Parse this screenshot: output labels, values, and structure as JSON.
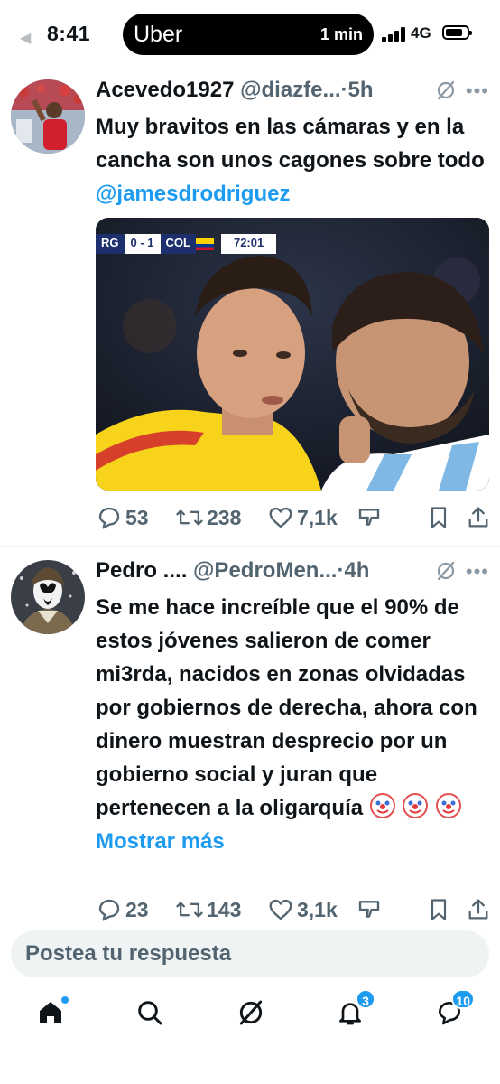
{
  "status_bar": {
    "time": "8:41",
    "app_pill": {
      "brand": "Uber",
      "eta": "1 min"
    },
    "network": "4G",
    "battery_level": 0.7
  },
  "posts": [
    {
      "display_name": "Acevedo1927",
      "handle": "@diazfe...",
      "separator": "·",
      "time": "5h",
      "text_before": "Muy bravitos en las cámaras y en la cancha son unos cagones sobre todo ",
      "mention": "@jamesdrodriguez",
      "media": {
        "scoreboard_left": "RG",
        "score": "0 - 1",
        "team_right": "COL",
        "clock": "72:01"
      },
      "replies": "53",
      "reposts": "238",
      "likes": "7,1k"
    },
    {
      "display_name": "Pedro ....",
      "handle": "@PedroMen...",
      "separator": "·",
      "time": "4h",
      "text": "Se me hace increíble que el 90% de estos jóvenes salieron de comer mi3rda, nacidos en zonas olvidadas por gobiernos de derecha, ahora con dinero muestran desprecio por un gobierno social y juran que pertenecen a la oligarquía",
      "show_more": "Mostrar más",
      "replies": "23",
      "reposts": "143",
      "likes": "3,1k"
    }
  ],
  "reply_box": {
    "placeholder": "Postea tu respuesta"
  },
  "bottom_nav": {
    "items": [
      "home",
      "search",
      "grok",
      "notifications",
      "messages"
    ],
    "notifications_badge": "3",
    "messages_badge": "10"
  },
  "colors": {
    "accent": "#1d9bf0",
    "text": "#0f1419",
    "secondary": "#536471"
  }
}
